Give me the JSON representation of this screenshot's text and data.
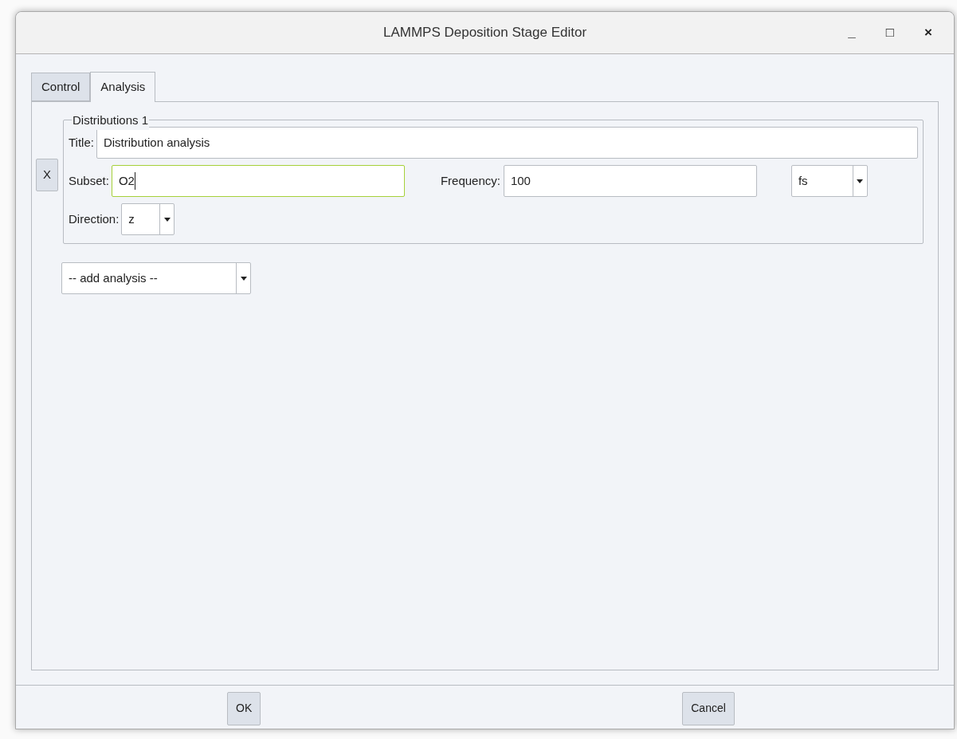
{
  "window": {
    "title": "LAMMPS Deposition Stage Editor",
    "controls": [
      "_",
      "□",
      "×"
    ]
  },
  "tabs": [
    {
      "label": "Control",
      "selected": false
    },
    {
      "label": "Analysis",
      "selected": true
    }
  ],
  "group": {
    "legend": "Distributions 1",
    "remove_button": "X",
    "title_field": {
      "label": "Title:",
      "value": "Distribution analysis",
      "focused": false
    },
    "subset_field": {
      "label": "Subset:",
      "value": "O2",
      "focused": true
    },
    "frequency_field": {
      "label": "Frequency:",
      "value": "100",
      "focused": false
    },
    "unit_combo": {
      "value": "fs"
    },
    "direction_combo": {
      "label": "Direction:",
      "value": "z"
    }
  },
  "add_combo": {
    "value": "-- add analysis --"
  },
  "buttons": [
    "OK",
    "Cancel"
  ]
}
